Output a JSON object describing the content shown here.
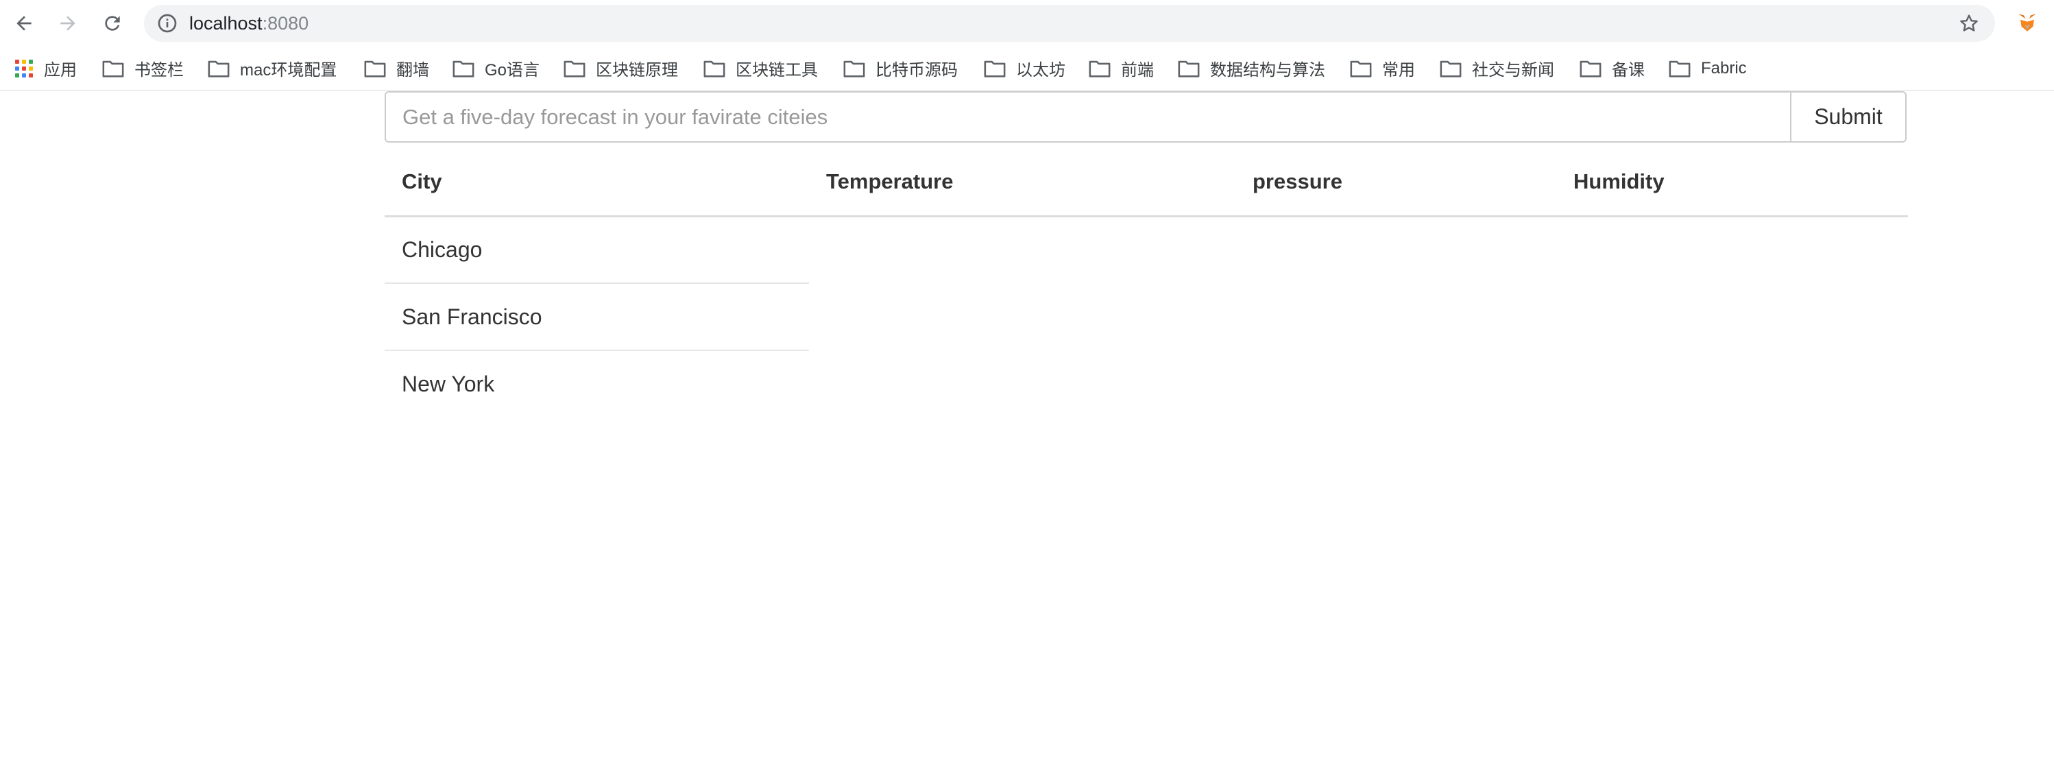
{
  "browser": {
    "url_host": "localhost",
    "url_port": ":8080",
    "icons": {
      "back": "back-arrow-icon",
      "forward": "forward-arrow-icon",
      "reload": "reload-icon",
      "info": "info-icon",
      "star": "star-icon",
      "extension": "metamask-fox-icon"
    }
  },
  "bookmarks": [
    {
      "label": "应用",
      "icon": "apps-grid-icon"
    },
    {
      "label": "书签栏",
      "icon": "folder-icon"
    },
    {
      "label": "mac环境配置",
      "icon": "folder-icon"
    },
    {
      "label": "翻墙",
      "icon": "folder-icon"
    },
    {
      "label": "Go语言",
      "icon": "folder-icon"
    },
    {
      "label": "区块链原理",
      "icon": "folder-icon"
    },
    {
      "label": "区块链工具",
      "icon": "folder-icon"
    },
    {
      "label": "比特币源码",
      "icon": "folder-icon"
    },
    {
      "label": "以太坊",
      "icon": "folder-icon"
    },
    {
      "label": "前端",
      "icon": "folder-icon"
    },
    {
      "label": "数据结构与算法",
      "icon": "folder-icon"
    },
    {
      "label": "常用",
      "icon": "folder-icon"
    },
    {
      "label": "社交与新闻",
      "icon": "folder-icon"
    },
    {
      "label": "备课",
      "icon": "folder-icon"
    },
    {
      "label": "Fabric",
      "icon": "folder-icon"
    }
  ],
  "search": {
    "placeholder": "Get a five-day forecast in your favirate citeies",
    "value": "",
    "submit_label": "Submit"
  },
  "table": {
    "headers": {
      "city": "City",
      "temperature": "Temperature",
      "pressure": "pressure",
      "humidity": "Humidity"
    },
    "rows": [
      {
        "city": "Chicago"
      },
      {
        "city": "San Francisco"
      },
      {
        "city": "New York"
      }
    ]
  }
}
